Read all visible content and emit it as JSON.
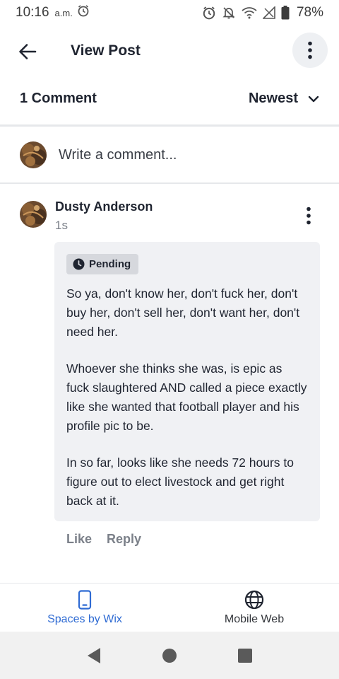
{
  "status_bar": {
    "time": "10:16",
    "ampm": "a.m.",
    "battery": "78%"
  },
  "app_bar": {
    "title": "View Post"
  },
  "comments_header": {
    "count_label": "1 Comment",
    "sort_label": "Newest"
  },
  "write_comment": {
    "placeholder": "Write a comment..."
  },
  "comment": {
    "author": "Dusty Anderson",
    "time": "1s",
    "badge": "Pending",
    "paragraphs": [
      "So ya, don't know her, don't fuck her, don't buy her, don't sell her, don't want her, don't need her.",
      "Whoever she thinks she was, is epic as fuck slaughtered AND called a piece exactly like she wanted that football player and his profile pic to be.",
      "In so far, looks like she needs 72 hours to figure out to elect livestock and get right back at it."
    ],
    "like_label": "Like",
    "reply_label": "Reply"
  },
  "bottom_tabs": [
    {
      "label": "Spaces by Wix",
      "icon": "phone-icon",
      "active": true
    },
    {
      "label": "Mobile Web",
      "icon": "globe-icon",
      "active": false
    }
  ],
  "colors": {
    "accent": "#2f6bd3",
    "bubble": "#f0f1f4",
    "badge": "#d6d8dd",
    "muted_text": "#7b8089"
  }
}
